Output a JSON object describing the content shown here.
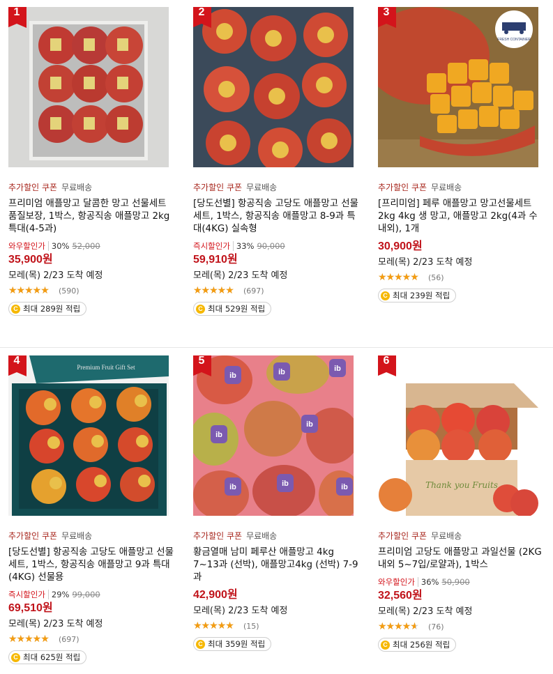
{
  "tag_coupon": "추가할인 쿠폰",
  "tag_free": "무료배송",
  "products": [
    {
      "rank": "1",
      "title": "프리미엄 애플망고 달콤한 망고 선물세트 품질보장, 1박스, 항공직송 애플망고 2kg 특대(4-5과)",
      "discount_label": "와우할인가",
      "discount_rate": "30%",
      "original_price": "52,000",
      "price": "35,900원",
      "delivery": "모레(목) 2/23 도착 예정",
      "rating": 4.5,
      "reviews": "(590)",
      "reward": "최대 289원 적립"
    },
    {
      "rank": "2",
      "title": "[당도선별] 항공직송 고당도 애플망고 선물세트, 1박스, 항공직송 애플망고 8-9과 특대(4KG) 실속형",
      "discount_label": "즉시할인가",
      "discount_rate": "33%",
      "original_price": "90,000",
      "price": "59,910원",
      "delivery": "모레(목) 2/23 도착 예정",
      "rating": 4.5,
      "reviews": "(697)",
      "reward": "최대 529원 적립"
    },
    {
      "rank": "3",
      "title": "[프리미엄] 페루 애플망고 망고선물세트 2kg 4kg 생 망고, 애플망고 2kg(4과 수내외), 1개",
      "discount_label": "",
      "discount_rate": "",
      "original_price": "",
      "price": "30,900원",
      "delivery": "모레(목) 2/23 도착 예정",
      "rating": 5,
      "reviews": "(56)",
      "reward": "최대 239원 적립",
      "badge_text": "FRESH CONTAINER"
    },
    {
      "rank": "4",
      "title": "[당도선별] 항공직송 고당도 애플망고 선물세트, 1박스, 항공직송 애플망고 9과 특대(4KG) 선물용",
      "discount_label": "즉시할인가",
      "discount_rate": "29%",
      "original_price": "99,000",
      "price": "69,510원",
      "delivery": "모레(목) 2/23 도착 예정",
      "rating": 4.5,
      "reviews": "(697)",
      "reward": "최대 625원 적립",
      "box_text": "Premium Fruit Gift Set"
    },
    {
      "rank": "5",
      "title": "황금열매 남미 페루산 애플망고 4kg 7~13과 (선박), 애플망고4kg (선박) 7-9과",
      "discount_label": "",
      "discount_rate": "",
      "original_price": "",
      "price": "42,900원",
      "delivery": "모레(목) 2/23 도착 예정",
      "rating": 4.5,
      "reviews": "(15)",
      "reward": "최대 359원 적립",
      "sticker_text": "ib"
    },
    {
      "rank": "6",
      "title": "프리미엄 고당도 애플망고 과일선물 (2KG 내외 5~7입/로얄과), 1박스",
      "discount_label": "와우할인가",
      "discount_rate": "36%",
      "original_price": "50,900",
      "price": "32,560원",
      "delivery": "모레(목) 2/23 도착 예정",
      "rating": 4,
      "reviews": "(76)",
      "reward": "최대 256원 적립",
      "box_text": "Thank you Fruits"
    }
  ],
  "colors": {
    "rank_badge": "#d3141b",
    "price": "#c0131a",
    "coupon_tag": "#a8271e",
    "star": "#f39c12",
    "coin": "#f6b800"
  },
  "icons": {
    "star": "star-icon",
    "coin": "coin-icon"
  }
}
